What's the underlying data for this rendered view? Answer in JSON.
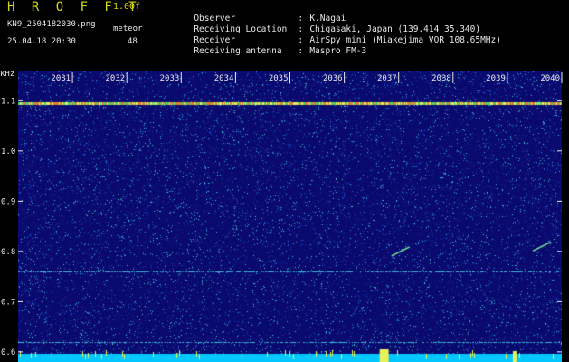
{
  "header": {
    "app_title": "H R O F F T",
    "version": "1.00f",
    "filename": "KN9_2504182030.png",
    "tag": "meteor",
    "datetime": "25.04.18 20:30",
    "count": "48"
  },
  "meta": [
    {
      "key": "Observer",
      "value": "K.Nagai"
    },
    {
      "key": "Receiving Location",
      "value": "Chigasaki, Japan (139.414 35.340)"
    },
    {
      "key": "Receiver",
      "value": "AirSpy mini (Miakejima VOR 108.65MHz)"
    },
    {
      "key": "Receiving antenna",
      "value": "Maspro FM-3"
    }
  ],
  "chart_data": {
    "type": "heatmap",
    "y_unit_label": "kHz",
    "x_tick_labels": [
      "2031",
      "2032",
      "2033",
      "2034",
      "2035",
      "2036",
      "2037",
      "2038",
      "2039",
      "2040"
    ],
    "y_tick_labels": [
      "1.1",
      "1.0",
      "0.9",
      "0.8",
      "0.7",
      "0.6"
    ],
    "x_range": [
      2030,
      2040
    ],
    "y_range": [
      0.58,
      1.16
    ],
    "colors": {
      "background": "#0a0a6e",
      "noise": "#1c64d0",
      "strong": "#e8f05a",
      "band": "#00c8ff"
    },
    "features": [
      {
        "kind": "carrier",
        "freq_khz": 1.095
      },
      {
        "kind": "carrier",
        "freq_khz": 0.76
      },
      {
        "kind": "carrier",
        "freq_khz": 0.62
      },
      {
        "kind": "meteor",
        "time": 2037.0,
        "freq_khz": 0.8
      },
      {
        "kind": "meteor",
        "time": 2039.6,
        "freq_khz": 0.81
      }
    ]
  }
}
